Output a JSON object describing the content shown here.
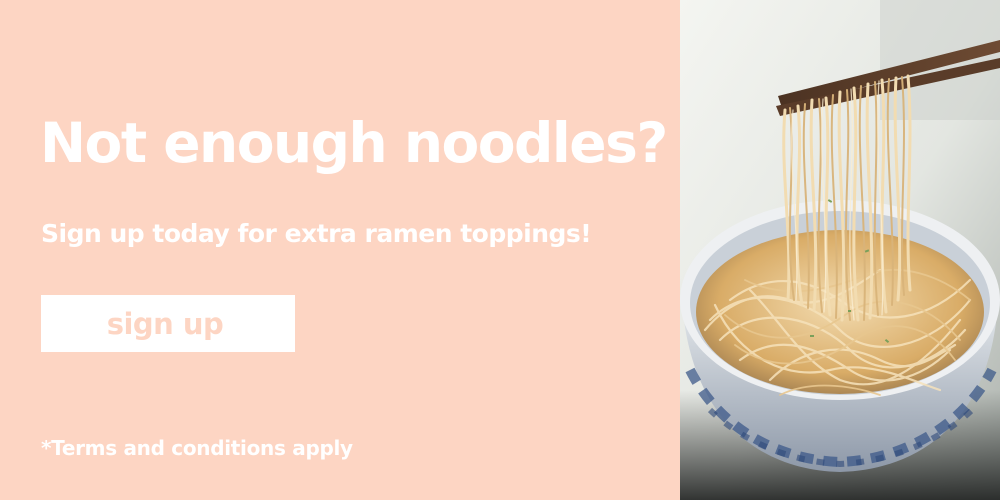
{
  "banner": {
    "headline": "Not enough noodles?",
    "subheadline": "Sign up today for extra ramen toppings!",
    "cta_label": "sign up",
    "terms": "*Terms and conditions apply"
  },
  "colors": {
    "panel_background": "#fdd5c3",
    "text": "#ffffff",
    "button_background": "#ffffff",
    "button_text": "#fdd5c3"
  },
  "image": {
    "subject": "noodles-lifted-with-chopsticks-from-bowl"
  }
}
